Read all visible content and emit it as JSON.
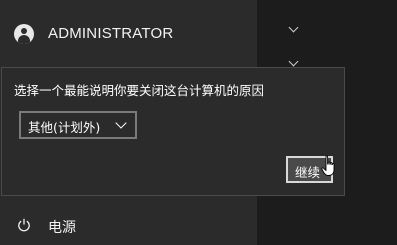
{
  "user": {
    "name": "ADMINISTRATOR",
    "icon": "user-avatar-icon"
  },
  "power": {
    "label": "电源",
    "icon": "power-icon"
  },
  "right_pane": {
    "icons": [
      "chevron-down-icon",
      "chevron-down-icon"
    ]
  },
  "shutdown_dialog": {
    "prompt": "选择一个最能说明你要关闭这台计算机的原因",
    "reason_selected": "其他(计划外)",
    "continue_label": "继续"
  },
  "colors": {
    "start_pane_bg": "#2b2b2b",
    "right_pane_bg": "#1c1c1c",
    "dialog_border": "#4a4a4a",
    "button_border": "#d8d8d8",
    "text": "#ffffff"
  }
}
